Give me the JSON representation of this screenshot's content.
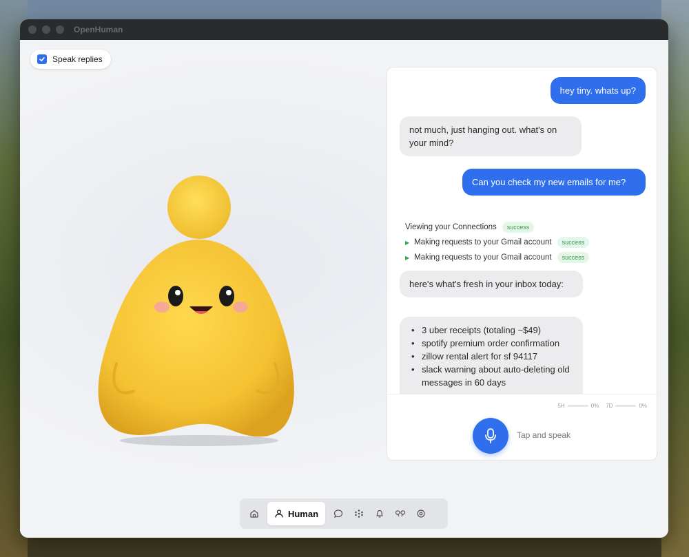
{
  "window": {
    "title": "OpenHuman"
  },
  "toolbar": {
    "speak_replies_label": "Speak replies",
    "speak_replies_checked": true
  },
  "chat": {
    "messages": [
      {
        "role": "user",
        "text": "hey tiny. whats up?"
      },
      {
        "role": "assistant",
        "text": "not much, just hanging out. what's on your mind?"
      },
      {
        "role": "user",
        "text": "Can you check my new emails for me?"
      }
    ],
    "tool_calls": [
      {
        "label": "Viewing your Connections",
        "status": "success"
      },
      {
        "label": "Making requests to your Gmail account",
        "status": "success"
      },
      {
        "label": "Making requests to your Gmail account",
        "status": "success"
      }
    ],
    "reply_intro": "here's what's fresh in your inbox today:",
    "reply_items": [
      "3 uber receipts (totaling ~$49)",
      "spotify premium order confirmation",
      "zillow rental alert for sf 94117",
      "slack warning about auto-deleting old messages in 60 days"
    ]
  },
  "voice": {
    "meter_a_label": "5H",
    "meter_a_value": "0%",
    "meter_b_label": "7D",
    "meter_b_value": "0%",
    "tap_label": "Tap and speak"
  },
  "nav": {
    "items": [
      "home-icon",
      "Human",
      "chat-icon",
      "skills-icon",
      "bell-icon",
      "connections-icon",
      "settings-icon"
    ],
    "active_label": "Human"
  },
  "colors": {
    "accent": "#2f6fed",
    "mascot": "#f5c63a",
    "success": "#3a9a56"
  }
}
